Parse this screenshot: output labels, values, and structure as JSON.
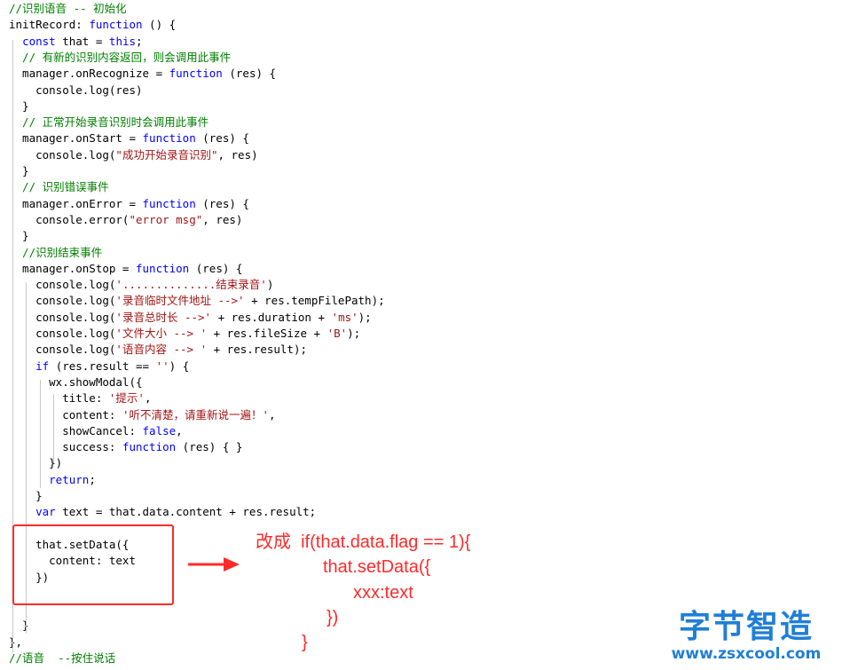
{
  "editor": {
    "lines": [
      [
        {
          "t": "//识别语音 -- 初始化",
          "c": "cm"
        }
      ],
      [
        {
          "t": "initRecord: ",
          "c": ""
        },
        {
          "t": "function",
          "c": "kw"
        },
        {
          "t": " () {",
          "c": ""
        }
      ],
      [
        {
          "t": "  ",
          "c": ""
        },
        {
          "t": "const",
          "c": "kw"
        },
        {
          "t": " that = ",
          "c": ""
        },
        {
          "t": "this",
          "c": "kw"
        },
        {
          "t": ";",
          "c": ""
        }
      ],
      [
        {
          "t": "  // 有新的识别内容返回，则会调用此事件",
          "c": "cm"
        }
      ],
      [
        {
          "t": "  manager.onRecognize = ",
          "c": ""
        },
        {
          "t": "function",
          "c": "kw"
        },
        {
          "t": " (res) {",
          "c": ""
        }
      ],
      [
        {
          "t": "    console.log(res)",
          "c": ""
        }
      ],
      [
        {
          "t": "  }",
          "c": ""
        }
      ],
      [
        {
          "t": "  // 正常开始录音识别时会调用此事件",
          "c": "cm"
        }
      ],
      [
        {
          "t": "  manager.onStart = ",
          "c": ""
        },
        {
          "t": "function",
          "c": "kw"
        },
        {
          "t": " (res) {",
          "c": ""
        }
      ],
      [
        {
          "t": "    console.log(",
          "c": ""
        },
        {
          "t": "\"成功开始录音识别\"",
          "c": "str"
        },
        {
          "t": ", res)",
          "c": ""
        }
      ],
      [
        {
          "t": "  }",
          "c": ""
        }
      ],
      [
        {
          "t": "  // 识别错误事件",
          "c": "cm"
        }
      ],
      [
        {
          "t": "  manager.onError = ",
          "c": ""
        },
        {
          "t": "function",
          "c": "kw"
        },
        {
          "t": " (res) {",
          "c": ""
        }
      ],
      [
        {
          "t": "    console.error(",
          "c": ""
        },
        {
          "t": "\"error msg\"",
          "c": "str"
        },
        {
          "t": ", res)",
          "c": ""
        }
      ],
      [
        {
          "t": "  }",
          "c": ""
        }
      ],
      [
        {
          "t": "  //识别结束事件",
          "c": "cm"
        }
      ],
      [
        {
          "t": "  manager.onStop = ",
          "c": ""
        },
        {
          "t": "function",
          "c": "kw"
        },
        {
          "t": " (res) {",
          "c": ""
        }
      ],
      [
        {
          "t": "    console.log(",
          "c": ""
        },
        {
          "t": "'..............结束录音'",
          "c": "str"
        },
        {
          "t": ")",
          "c": ""
        }
      ],
      [
        {
          "t": "    console.log(",
          "c": ""
        },
        {
          "t": "'录音临时文件地址 -->'",
          "c": "str"
        },
        {
          "t": " + res.tempFilePath);",
          "c": ""
        }
      ],
      [
        {
          "t": "    console.log(",
          "c": ""
        },
        {
          "t": "'录音总时长 -->'",
          "c": "str"
        },
        {
          "t": " + res.duration + ",
          "c": ""
        },
        {
          "t": "'ms'",
          "c": "str"
        },
        {
          "t": ");",
          "c": ""
        }
      ],
      [
        {
          "t": "    console.log(",
          "c": ""
        },
        {
          "t": "'文件大小 --> '",
          "c": "str"
        },
        {
          "t": " + res.fileSize + ",
          "c": ""
        },
        {
          "t": "'B'",
          "c": "str"
        },
        {
          "t": ");",
          "c": ""
        }
      ],
      [
        {
          "t": "    console.log(",
          "c": ""
        },
        {
          "t": "'语音内容 --> '",
          "c": "str"
        },
        {
          "t": " + res.result);",
          "c": ""
        }
      ],
      [
        {
          "t": "    ",
          "c": ""
        },
        {
          "t": "if",
          "c": "kw"
        },
        {
          "t": " (res.result == ",
          "c": ""
        },
        {
          "t": "''",
          "c": "str"
        },
        {
          "t": ") {",
          "c": ""
        }
      ],
      [
        {
          "t": "      wx.showModal({",
          "c": ""
        }
      ],
      [
        {
          "t": "        title: ",
          "c": ""
        },
        {
          "t": "'提示'",
          "c": "str"
        },
        {
          "t": ",",
          "c": ""
        }
      ],
      [
        {
          "t": "        content: ",
          "c": ""
        },
        {
          "t": "'听不清楚，请重新说一遍！'",
          "c": "str"
        },
        {
          "t": ",",
          "c": ""
        }
      ],
      [
        {
          "t": "        showCancel: ",
          "c": ""
        },
        {
          "t": "false",
          "c": "kw"
        },
        {
          "t": ",",
          "c": ""
        }
      ],
      [
        {
          "t": "        success: ",
          "c": ""
        },
        {
          "t": "function",
          "c": "kw"
        },
        {
          "t": " (res) { }",
          "c": ""
        }
      ],
      [
        {
          "t": "      })",
          "c": ""
        }
      ],
      [
        {
          "t": "      ",
          "c": ""
        },
        {
          "t": "return",
          "c": "kw"
        },
        {
          "t": ";",
          "c": ""
        }
      ],
      [
        {
          "t": "    }",
          "c": ""
        }
      ],
      [
        {
          "t": "    ",
          "c": ""
        },
        {
          "t": "var",
          "c": "kw"
        },
        {
          "t": " text = that.data.content + res.result;",
          "c": ""
        }
      ],
      [
        {
          "t": "",
          "c": ""
        }
      ],
      [
        {
          "t": "    that.setData({",
          "c": ""
        }
      ],
      [
        {
          "t": "      content: text",
          "c": ""
        }
      ],
      [
        {
          "t": "    })",
          "c": ""
        }
      ],
      [
        {
          "t": "",
          "c": ""
        }
      ],
      [
        {
          "t": "",
          "c": ""
        }
      ],
      [
        {
          "t": "  }",
          "c": ""
        }
      ],
      [
        {
          "t": "},",
          "c": ""
        }
      ],
      [
        {
          "t": "//语音  --按住说话",
          "c": "cm"
        }
      ]
    ]
  },
  "annotation": {
    "lines": [
      "改成  if(that.data.flag == 1){",
      "that.setData({",
      "xxx:text",
      "})",
      "}"
    ]
  },
  "watermark": {
    "title": "字节智造",
    "url": "www.zsxcool.com"
  },
  "colors": {
    "keyword": "#0000ff",
    "string": "#a31515",
    "comment": "#008000",
    "annotation": "#ff2a2a",
    "watermark": "#1f7fd6"
  }
}
